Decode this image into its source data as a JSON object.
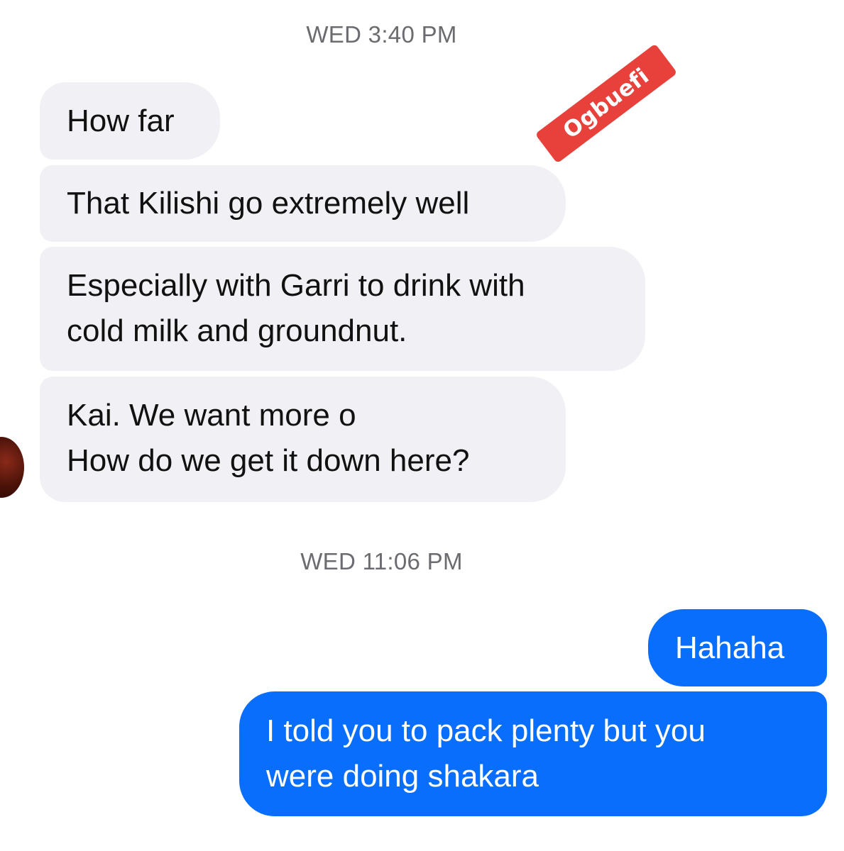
{
  "conversation": {
    "timestamps": [
      "WED 3:40 PM",
      "WED 11:06 PM"
    ],
    "incoming": [
      "How far",
      "That Kilishi go extremely well",
      "Especially with Garri to drink with\ncold milk and groundnut.",
      "Kai. We want more o\nHow do we get it down here?"
    ],
    "outgoing": [
      "Hahaha",
      "I told you to pack plenty but you\nwere doing shakara"
    ]
  },
  "watermark": {
    "text": "Ogbuefi"
  },
  "colors": {
    "incoming_bubble": "#f1f1f5",
    "outgoing_bubble": "#0a6efc",
    "watermark_bg": "#e8413b"
  }
}
